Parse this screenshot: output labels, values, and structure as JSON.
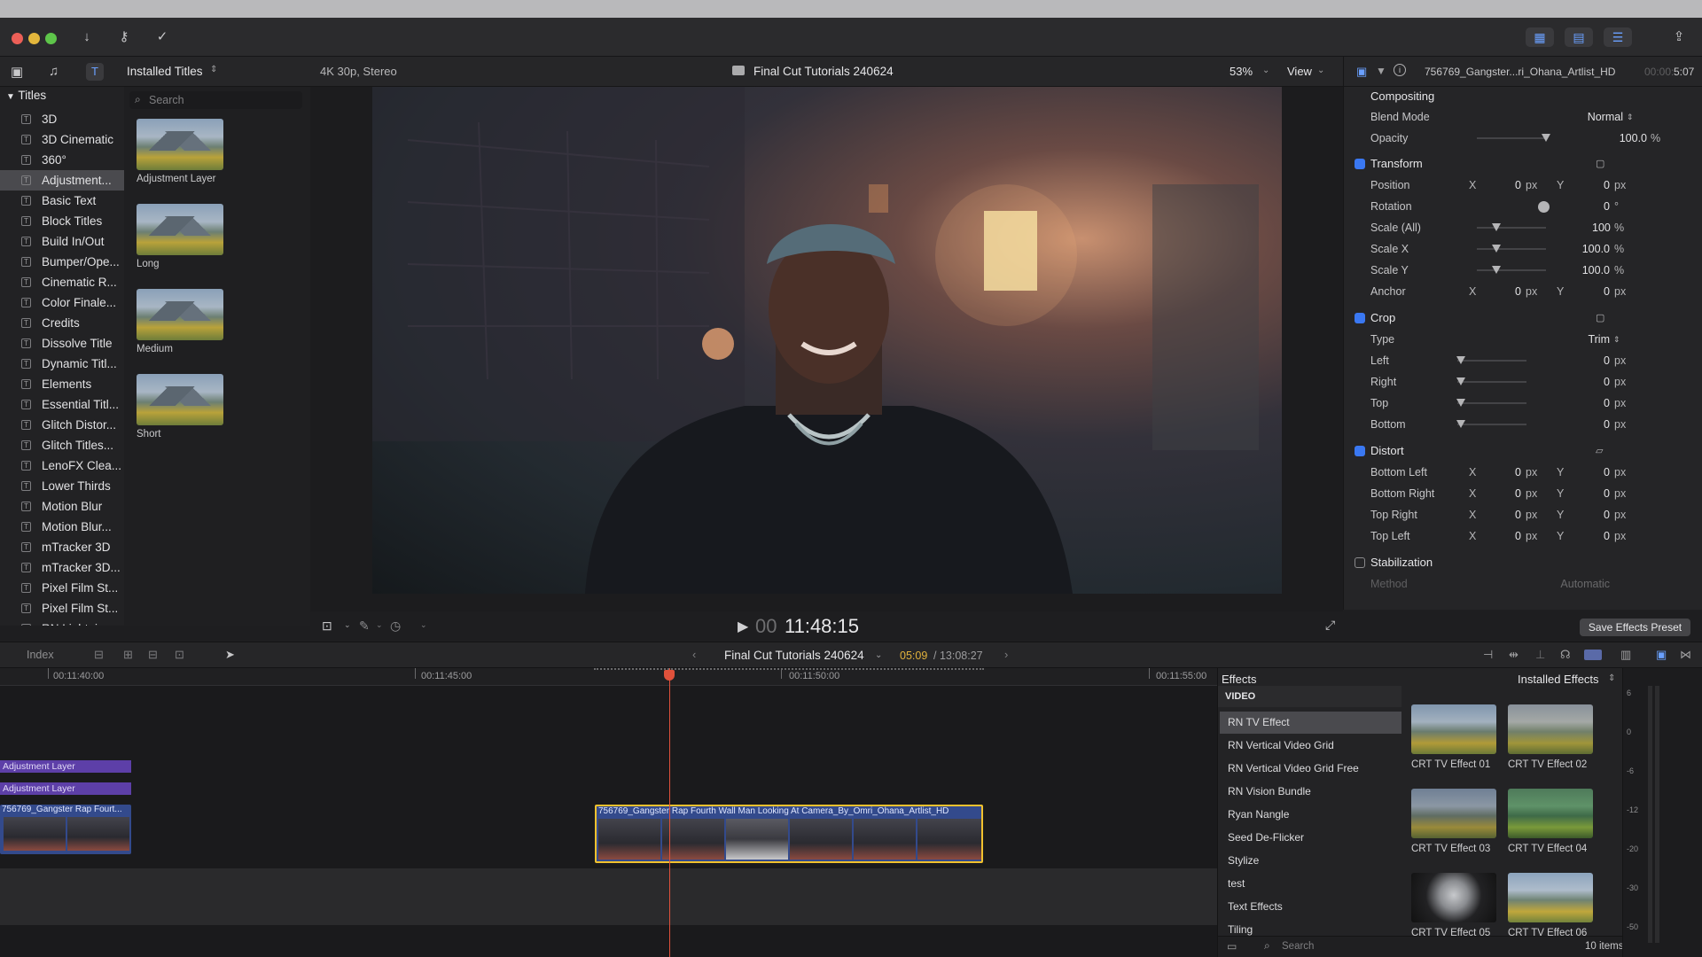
{
  "browser": {
    "title": "Installed Titles",
    "search_placeholder": "Search",
    "root": "Titles",
    "categories": [
      "3D",
      "3D Cinematic",
      "360°",
      "Adjustment...",
      "Basic Text",
      "Block Titles",
      "Build In/Out",
      "Bumper/Ope...",
      "Cinematic R...",
      "Color Finale...",
      "Credits",
      "Dissolve Title",
      "Dynamic Titl...",
      "Elements",
      "Essential Titl...",
      "Glitch Distor...",
      "Glitch Titles...",
      "LenoFX Clea...",
      "Lower Thirds",
      "Motion Blur",
      "Motion Blur...",
      "mTracker 3D",
      "mTracker 3D...",
      "Pixel Film St...",
      "Pixel Film St...",
      "RN Lightning..."
    ],
    "selected_index": 3,
    "thumbnails": [
      "Adjustment Layer",
      "Long",
      "Medium",
      "Short"
    ]
  },
  "viewer": {
    "format": "4K 30p, Stereo",
    "project": "Final Cut Tutorials 240624",
    "zoom": "53%",
    "view": "View",
    "timecode_dim": "00",
    "timecode": "11:48:15"
  },
  "inspector": {
    "clip_name": "756769_Gangster...ri_Ohana_Artlist_HD",
    "duration_dim": "00:00:",
    "duration": "5:07",
    "compositing": "Compositing",
    "blend_mode_label": "Blend Mode",
    "blend_mode": "Normal",
    "opacity_label": "Opacity",
    "opacity": "100.0",
    "pct": "%",
    "transform": "Transform",
    "position_label": "Position",
    "rotation_label": "Rotation",
    "rotation": "0",
    "deg": "°",
    "scale_all_label": "Scale (All)",
    "scale_all": "100",
    "scale_x_label": "Scale X",
    "scale_x": "100.0",
    "scale_y_label": "Scale Y",
    "scale_y": "100.0",
    "anchor_label": "Anchor",
    "crop": "Crop",
    "type_label": "Type",
    "type_value": "Trim",
    "left_label": "Left",
    "right_label": "Right",
    "top_label": "Top",
    "bottom_label": "Bottom",
    "distort": "Distort",
    "bottom_left_label": "Bottom Left",
    "bottom_right_label": "Bottom Right",
    "top_right_label": "Top Right",
    "top_left_label": "Top Left",
    "stabilization": "Stabilization",
    "method_label": "Method",
    "method_value": "Automatic",
    "x": "X",
    "y": "Y",
    "zero": "0",
    "px": "px",
    "save_preset": "Save Effects Preset"
  },
  "timeline": {
    "index": "Index",
    "project": "Final Cut Tutorials 240624",
    "position": "05:09",
    "total": "/ 13:08:27",
    "ruler": [
      "00:11:40:00",
      "00:11:45:00",
      "00:11:50:00",
      "00:11:55:00"
    ],
    "adjustment_layer": "Adjustment Layer",
    "clip_left": "756769_Gangster Rap Fourt...",
    "clip_main": "756769_Gangster Rap Fourth Wall Man Looking At Camera_By_Omri_Ohana_Artlist_HD"
  },
  "effects": {
    "title": "Effects",
    "source": "Installed Effects",
    "section": "VIDEO",
    "list": [
      "RN TV Effect",
      "RN Vertical Video Grid",
      "RN Vertical Video Grid Free",
      "RN Vision Bundle",
      "Ryan Nangle",
      "Seed De-Flicker",
      "Stylize",
      "test",
      "Text Effects",
      "Tiling"
    ],
    "selected_index": 0,
    "thumbs": [
      "CRT TV Effect 01",
      "CRT TV Effect 02",
      "CRT TV Effect 03",
      "CRT TV Effect 04",
      "CRT TV Effect 05",
      "CRT TV Effect 06"
    ],
    "search_placeholder": "Search",
    "count": "10 items"
  },
  "meter": {
    "labels": [
      "6",
      "0",
      "-6",
      "-12",
      "-20",
      "-30",
      "-50"
    ]
  },
  "colors": {
    "accent": "#3a78f2",
    "playhead": "#e0513b",
    "adjustment_clip": "#5d3fa8",
    "video_clip": "#334a8c",
    "selection_yellow": "#f2c12e"
  }
}
